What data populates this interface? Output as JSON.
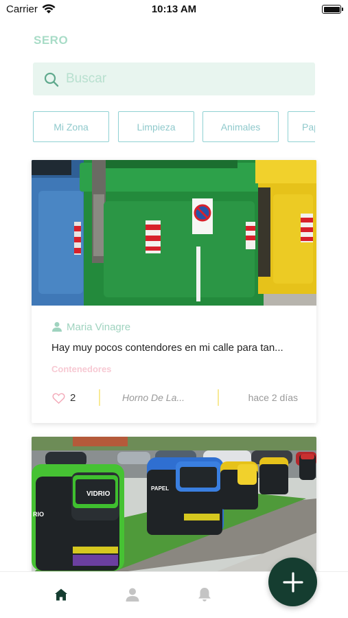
{
  "status_bar": {
    "carrier": "Carrier",
    "time": "10:13 AM"
  },
  "app": {
    "title": "SERO"
  },
  "search": {
    "placeholder": "Buscar",
    "value": ""
  },
  "categories": [
    {
      "label": "Mi Zona"
    },
    {
      "label": "Limpieza"
    },
    {
      "label": "Animales"
    },
    {
      "label": "Pap"
    }
  ],
  "posts": [
    {
      "author": "Maria Vinagre",
      "text": "Hay muy pocos contendores en mi calle para tan...",
      "tag": "Contenedores",
      "likes": "2",
      "location": "Horno De La...",
      "time_ago": "hace 2 días"
    }
  ],
  "tab_bar": {
    "tabs": [
      {
        "icon": "home-icon",
        "active": true
      },
      {
        "icon": "profile-icon",
        "active": false
      },
      {
        "icon": "bell-icon",
        "active": false
      }
    ],
    "fab_icon": "plus-icon"
  },
  "colors": {
    "brand_light": "#a8dcc7",
    "search_bg": "#e8f5ef",
    "chip_border": "#8fd1d3",
    "tag_pink": "#f7c9d3",
    "divider_yellow": "#f8ea96",
    "fab_dark": "#153d30"
  }
}
